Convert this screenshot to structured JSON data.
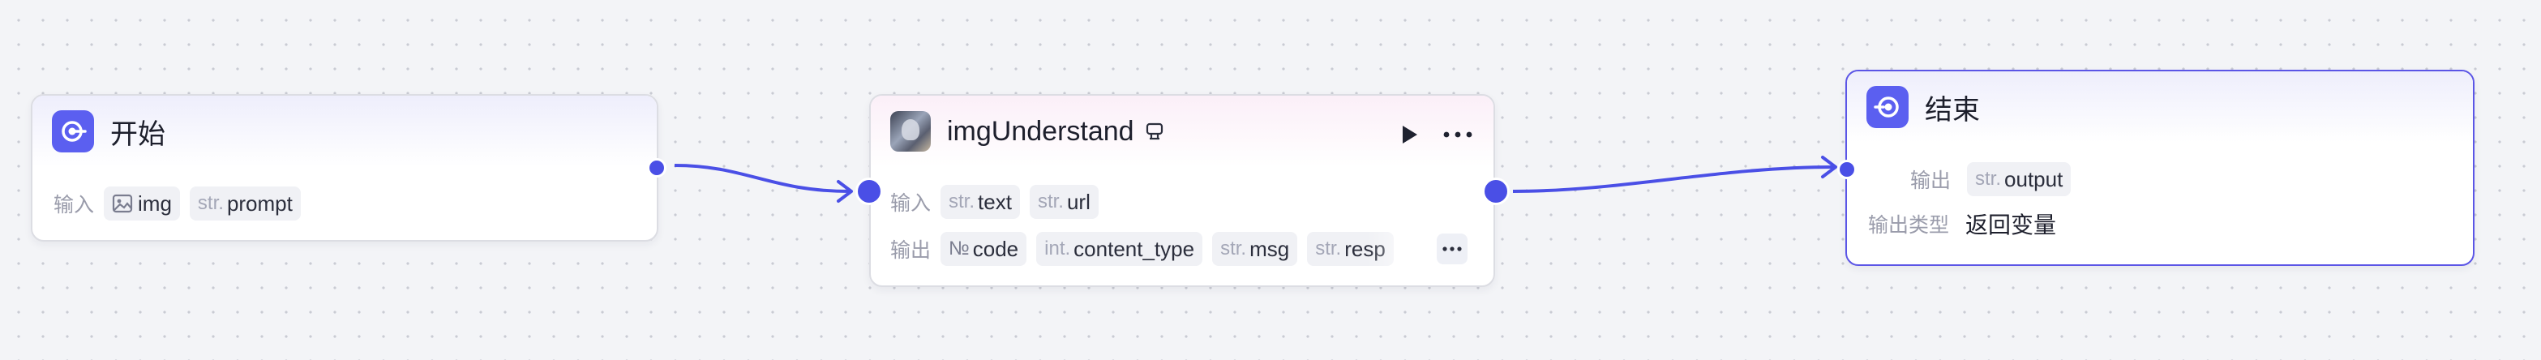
{
  "colors": {
    "accent": "#4a4fe6",
    "node_border": "#dcdde3",
    "canvas": "#f3f4f7"
  },
  "start_node": {
    "title": "开始",
    "icon": "start-flow-icon",
    "input_label": "输入",
    "inputs": [
      {
        "type": "",
        "icon": "image-icon",
        "name": "img"
      },
      {
        "type": "str.",
        "name": "prompt"
      }
    ]
  },
  "understand_node": {
    "title": "imgUnderstand",
    "icon": "plugin-thumbnail-icon",
    "badge_icon": "plugin-badge-icon",
    "run_icon": "play-icon",
    "menu_icon": "more-dots-icon",
    "input_label": "输入",
    "inputs": [
      {
        "type": "str.",
        "name": "text"
      },
      {
        "type": "str.",
        "name": "url"
      }
    ],
    "output_label": "输出",
    "outputs": [
      {
        "type": "№",
        "name": "code"
      },
      {
        "type": "int.",
        "name": "content_type"
      },
      {
        "type": "str.",
        "name": "msg"
      },
      {
        "type": "str.",
        "name": "resp"
      }
    ],
    "outputs_more_icon": "more-dots-icon"
  },
  "end_node": {
    "title": "结束",
    "icon": "end-flow-icon",
    "output_label": "输出",
    "outputs": [
      {
        "type": "str.",
        "name": "output"
      }
    ],
    "output_type_label": "输出类型",
    "output_type_value": "返回变量"
  }
}
